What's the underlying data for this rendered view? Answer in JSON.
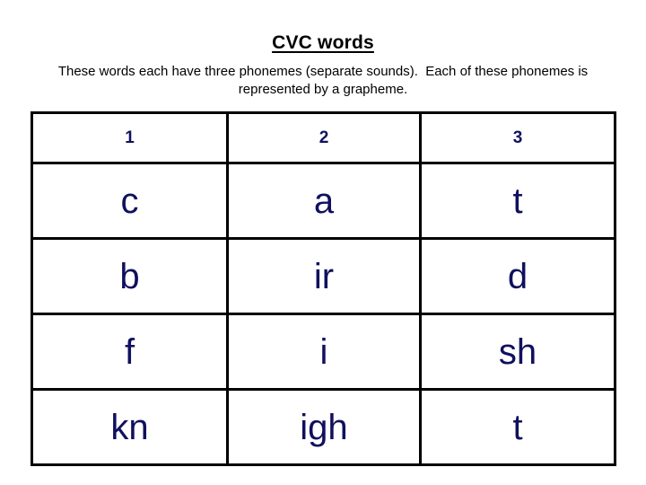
{
  "slide": {
    "title": "CVC words",
    "subtitle": "These words each have three phonemes (separate sounds).  Each of these phonemes is represented by a grapheme.",
    "colors": {
      "text_navy": "#10105e",
      "text_black": "#000000",
      "border": "#000000",
      "background": "#ffffff"
    }
  },
  "table": {
    "headers": [
      "1",
      "2",
      "3"
    ],
    "rows": [
      {
        "word": "cat",
        "graphemes": [
          "c",
          "a",
          "t"
        ]
      },
      {
        "word": "bird",
        "graphemes": [
          "b",
          "ir",
          "d"
        ]
      },
      {
        "word": "fish",
        "graphemes": [
          "f",
          "i",
          "sh"
        ]
      },
      {
        "word": "knight",
        "graphemes": [
          "kn",
          "igh",
          "t"
        ]
      }
    ]
  }
}
